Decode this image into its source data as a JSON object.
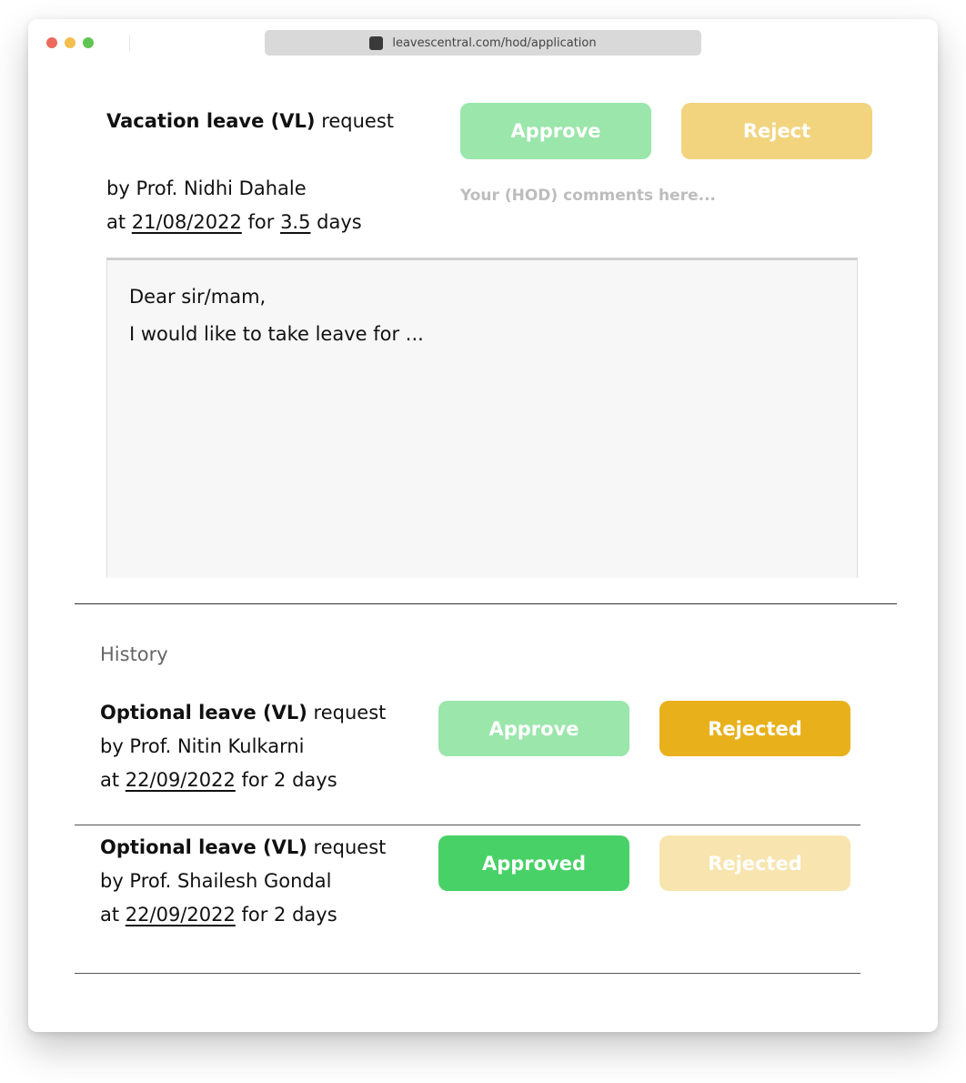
{
  "browser": {
    "url": "leavescentral.com/hod/application",
    "traffic_lights": {
      "close": "#ec6a5e",
      "minimize": "#f4bf4f",
      "maximize": "#61c554"
    }
  },
  "request": {
    "leave_type": "Vacation leave (VL)",
    "suffix": " request",
    "by_prefix": "by ",
    "applicant": "Prof. Nidhi Dahale",
    "at_prefix": "at ",
    "date": "21/08/2022",
    "for_text": " for ",
    "duration": "3.5",
    "days_text": " days",
    "approve_label": "Approve",
    "reject_label": "Reject",
    "comment_placeholder": "Your (HOD) comments here...",
    "letter": {
      "line1": "Dear sir/mam,",
      "line2": "I would like to take leave for ..."
    }
  },
  "history": {
    "label": "History",
    "items": [
      {
        "leave_type": "Optional leave (VL)",
        "suffix": " request",
        "by_line": "by Prof. Nitin Kulkarni",
        "at_prefix": "at ",
        "date": "22/09/2022",
        "duration_text": " for 2 days",
        "approve_label": "Approve",
        "reject_label": "Rejected",
        "status": "rejected"
      },
      {
        "leave_type": "Optional leave (VL)",
        "suffix": " request",
        "by_line": "by Prof. Shailesh Gondal",
        "at_prefix": "at ",
        "date": "22/09/2022",
        "duration_text": " for 2 days",
        "approve_label": "Approved",
        "reject_label": "Rejected",
        "status": "approved"
      }
    ]
  },
  "colors": {
    "approve_faded": "#9ae6ab",
    "approve_active": "#48d166",
    "reject_faded": "#f2d47e",
    "reject_active": "#e8b11c",
    "reject_pale": "#f7e4ae"
  }
}
